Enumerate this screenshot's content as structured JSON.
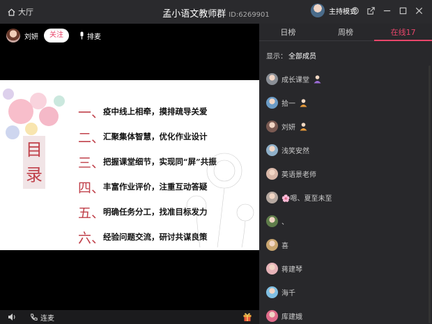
{
  "titlebar": {
    "home_label": "大厅",
    "title": "孟小语文教师群",
    "room_id": "ID:6269901",
    "host_mode_label": "主持模式"
  },
  "video": {
    "presenter_name": "刘妍",
    "follow_label": "关注",
    "mic_queue_label": "排麦"
  },
  "slide": {
    "heading": "目录",
    "items": [
      {
        "num": "一、",
        "text": "疫中线上相牵，摸排疏导关爱"
      },
      {
        "num": "二、",
        "text": "汇聚集体智慧，优化作业设计"
      },
      {
        "num": "三、",
        "text": "把握课堂细节，实现同“屏”共振"
      },
      {
        "num": "四、",
        "text": "丰富作业评价，注重互动答疑"
      },
      {
        "num": "五、",
        "text": "明确任务分工，找准目标发力"
      },
      {
        "num": "六、",
        "text": "经验问题交流，研讨共谋良策"
      }
    ]
  },
  "bottombar": {
    "connect_mic_label": "连麦"
  },
  "panel": {
    "tabs": [
      {
        "label": "日榜"
      },
      {
        "label": "周榜"
      },
      {
        "label": "在线17"
      }
    ],
    "display_prefix": "显示：",
    "display_value": "全部成员",
    "members": [
      {
        "name": "成长课堂",
        "avatar_color": "#8a8f96",
        "badge": "admin-icon"
      },
      {
        "name": "拾一",
        "avatar_color": "#6a9bc6",
        "badge": "host-icon"
      },
      {
        "name": "刘妍",
        "avatar_color": "#7a5a52",
        "badge": "host-icon"
      },
      {
        "name": "浅笑安然",
        "avatar_color": "#8fb0c9",
        "badge": ""
      },
      {
        "name": "英语景老师",
        "avatar_color": "#d8b7a8",
        "badge": ""
      },
      {
        "name": "🌸嗯、夏至未至",
        "avatar_color": "#b5a8a0",
        "badge": ""
      },
      {
        "name": "、",
        "avatar_color": "#5f7d4a",
        "badge": ""
      },
      {
        "name": "喜",
        "avatar_color": "#c9a56f",
        "badge": ""
      },
      {
        "name": "蒋建琴",
        "avatar_color": "#e6b3b8",
        "badge": ""
      },
      {
        "name": "海千",
        "avatar_color": "#7fbfe3",
        "badge": ""
      },
      {
        "name": "库建娥",
        "avatar_color": "#e06b8a",
        "badge": ""
      }
    ]
  },
  "colors": {
    "accent": "#e8466b",
    "slide_red": "#c0404a"
  }
}
